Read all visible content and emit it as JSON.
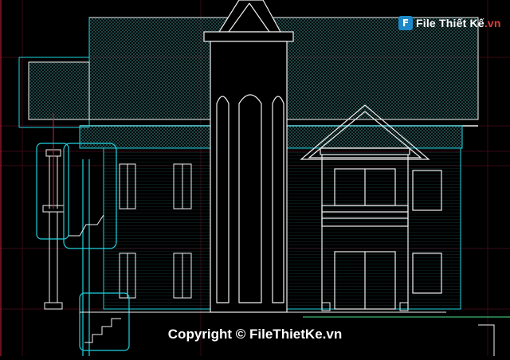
{
  "logo": {
    "badge": "F",
    "name_main": "File Thiết Kế",
    "name_suffix": ".vn"
  },
  "watermark": {
    "text": "Copyright © FileThietKe.vn"
  },
  "colors": {
    "background": "#000000",
    "cyan": "#1fd3df",
    "white": "#f0f0f0",
    "red": "#d0243a",
    "green": "#3cb86e",
    "hatch": "#2f6a6a",
    "grid": "#3a0a14"
  }
}
